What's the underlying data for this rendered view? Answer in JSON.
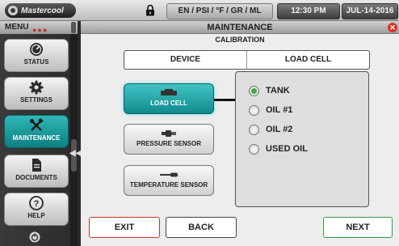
{
  "topbar": {
    "logo_text": "Mastercool",
    "units": "EN / PSI / °F / GR / ML",
    "time": "12:30 PM",
    "date": "JUL-14-2016"
  },
  "sidebar": {
    "menu_label": "MENU",
    "items": [
      {
        "label": "STATUS",
        "icon": "gauge-icon",
        "active": false
      },
      {
        "label": "SETTINGS",
        "icon": "gear-icon",
        "active": false
      },
      {
        "label": "MAINTENANCE",
        "icon": "tools-icon",
        "active": true
      },
      {
        "label": "DOCUMENTS",
        "icon": "document-icon",
        "active": false
      },
      {
        "label": "HELP",
        "icon": "help-icon",
        "active": false
      }
    ]
  },
  "panel": {
    "title": "MAINTENANCE",
    "subtitle": "CALIBRATION",
    "tabs": [
      "DEVICE",
      "LOAD CELL"
    ],
    "sensors": [
      {
        "label": "LOAD CELL",
        "icon": "load-cell-icon",
        "selected": true
      },
      {
        "label": "PRESSURE SENSOR",
        "icon": "pressure-sensor-icon",
        "selected": false
      },
      {
        "label": "TEMPERATURE SENSOR",
        "icon": "temperature-sensor-icon",
        "selected": false
      }
    ],
    "options": [
      {
        "label": "TANK",
        "selected": true
      },
      {
        "label": "OIL #1",
        "selected": false
      },
      {
        "label": "OIL #2",
        "selected": false
      },
      {
        "label": "USED OIL",
        "selected": false
      }
    ],
    "buttons": {
      "exit": "EXIT",
      "back": "BACK",
      "next": "NEXT"
    }
  },
  "colors": {
    "accent": "#1a9ea1",
    "exit_border": "#c0392b",
    "next_border": "#2e9e3e",
    "radio_on": "#3cae3c"
  }
}
